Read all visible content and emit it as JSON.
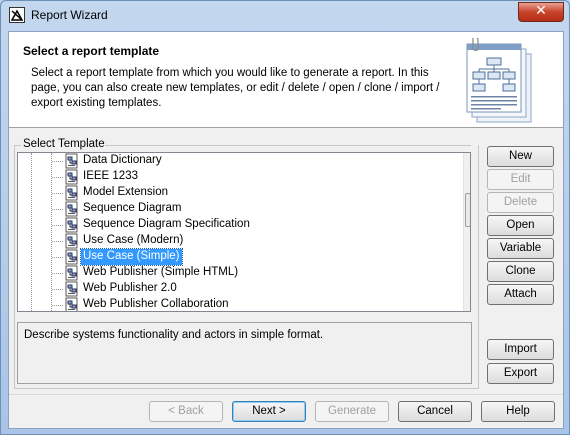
{
  "window": {
    "title": "Report Wizard",
    "close_symbol": "✕"
  },
  "header": {
    "title": "Select a report template",
    "description": "Select a report template from which you would like to generate a report. In this page, you can also create new templates, or edit / delete / open / clone / import / export existing templates."
  },
  "template_group": {
    "label": "Select Template",
    "items": [
      {
        "label": "Data Dictionary"
      },
      {
        "label": "IEEE 1233"
      },
      {
        "label": "Model Extension"
      },
      {
        "label": "Sequence Diagram"
      },
      {
        "label": "Sequence Diagram Specification"
      },
      {
        "label": "Use Case (Modern)"
      },
      {
        "label": "Use Case (Simple)",
        "selected": true
      },
      {
        "label": "Web Publisher (Simple HTML)"
      },
      {
        "label": "Web Publisher 2.0"
      },
      {
        "label": "Web Publisher Collaboration"
      }
    ],
    "selected_description": "Describe systems functionality and actors in simple format."
  },
  "side_buttons": {
    "new": "New",
    "edit": "Edit",
    "delete": "Delete",
    "open": "Open",
    "variable": "Variable",
    "clone": "Clone",
    "attach": "Attach",
    "import": "Import",
    "export": "Export"
  },
  "footer_buttons": {
    "back": "< Back",
    "next": "Next >",
    "generate": "Generate",
    "cancel": "Cancel",
    "help": "Help"
  },
  "colors": {
    "selection": "#3399ff",
    "titlebar": "#b9d1ea",
    "close": "#c7432a"
  }
}
